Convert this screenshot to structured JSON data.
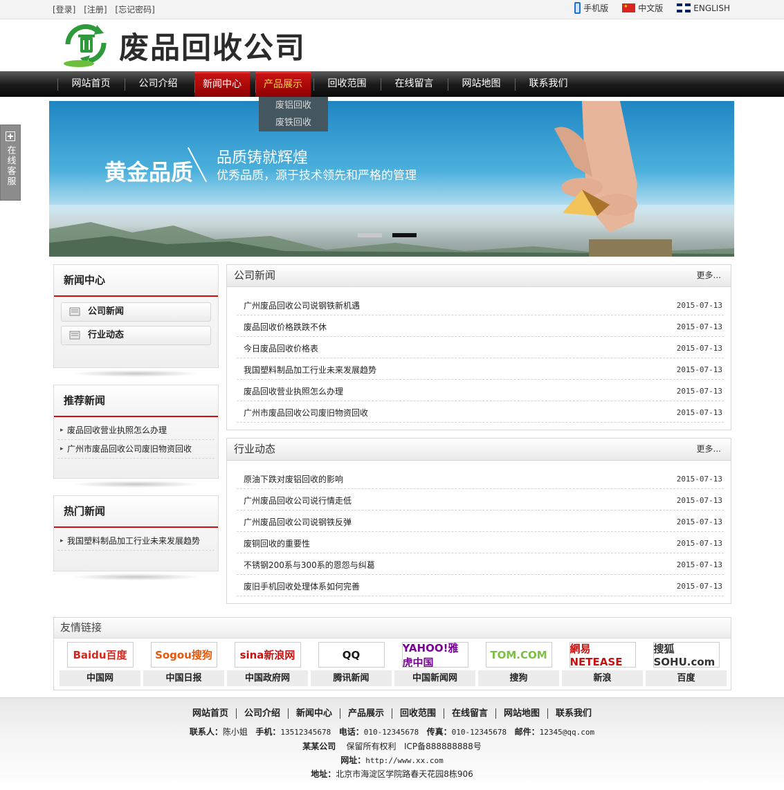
{
  "topbar": {
    "login": "[登录]",
    "register": "[注册]",
    "forgot": "[忘记密码]",
    "mobile": "手机版",
    "chinese": "中文版",
    "english": "ENGLISH"
  },
  "header": {
    "title": "废品回收公司"
  },
  "nav": {
    "items": [
      "网站首页",
      "公司介绍",
      "新闻中心",
      "产品展示",
      "回收范围",
      "在线留言",
      "网站地图",
      "联系我们"
    ],
    "dropdown": [
      "废铝回收",
      "废铁回收"
    ]
  },
  "banner": {
    "headline": "黄金品质",
    "tagline": "品质铸就辉煌",
    "subline": "优秀品质，源于技术领先和严格的管理"
  },
  "service": {
    "label": "在线客服"
  },
  "sidebar": {
    "news_center": {
      "title": "新闻中心",
      "items": [
        "公司新闻",
        "行业动态"
      ]
    },
    "recommended": {
      "title": "推荐新闻",
      "items": [
        "废品回收营业执照怎么办理",
        "广州市废品回收公司废旧物资回收"
      ]
    },
    "hot": {
      "title": "热门新闻",
      "items": [
        "我国塑料制品加工行业未来发展趋势"
      ]
    }
  },
  "company_news": {
    "title": "公司新闻",
    "more": "更多...",
    "items": [
      {
        "title": "广州废品回收公司说钢铁新机遇",
        "date": "2015-07-13"
      },
      {
        "title": "废品回收价格跌跌不休",
        "date": "2015-07-13"
      },
      {
        "title": "今日废品回收价格表",
        "date": "2015-07-13"
      },
      {
        "title": "我国塑料制品加工行业未来发展趋势",
        "date": "2015-07-13"
      },
      {
        "title": "废品回收营业执照怎么办理",
        "date": "2015-07-13"
      },
      {
        "title": "广州市废品回收公司废旧物资回收",
        "date": "2015-07-13"
      }
    ]
  },
  "industry_news": {
    "title": "行业动态",
    "more": "更多...",
    "items": [
      {
        "title": "原油下跌对废铝回收的影响",
        "date": "2015-07-13"
      },
      {
        "title": "广州废品回收公司说行情走低",
        "date": "2015-07-13"
      },
      {
        "title": "广州废品回收公司说钢铁反弹",
        "date": "2015-07-13"
      },
      {
        "title": "废铜回收的重要性",
        "date": "2015-07-13"
      },
      {
        "title": "不锈钢200系与300系的恩怨与纠葛",
        "date": "2015-07-13"
      },
      {
        "title": "废旧手机回收处理体系如何完善",
        "date": "2015-07-13"
      }
    ]
  },
  "friend_links": {
    "title": "友情链接",
    "items": [
      {
        "logo": "Baidu百度",
        "caption": "中国网",
        "color": "#d8261c"
      },
      {
        "logo": "Sogou搜狗",
        "caption": "中国日报",
        "color": "#e8580c"
      },
      {
        "logo": "sina新浪网",
        "caption": "中国政府网",
        "color": "#c81010"
      },
      {
        "logo": "QQ",
        "caption": "腾讯新闻",
        "color": "#1a1a1a"
      },
      {
        "logo": "YAHOO!雅虎中国",
        "caption": "中国新闻网",
        "color": "#7b0099"
      },
      {
        "logo": "TOM.COM",
        "caption": "搜狗",
        "color": "#7bc043"
      },
      {
        "logo": "網易 NETEASE",
        "caption": "新浪",
        "color": "#c81010"
      },
      {
        "logo": "搜狐 SOHU.com",
        "caption": "百度",
        "color": "#333333"
      }
    ]
  },
  "footer": {
    "nav": [
      "网站首页",
      "公司介绍",
      "新闻中心",
      "产品展示",
      "回收范围",
      "在线留言",
      "网站地图",
      "联系我们"
    ],
    "contact_label": "联系人：",
    "contact": "陈小姐",
    "mobile_label": "手机：",
    "mobile": "13512345678",
    "phone_label": "电话：",
    "phone": "010-12345678",
    "fax_label": "传真：",
    "fax": "010-12345678",
    "email_label": "邮件：",
    "email": "12345@qq.com",
    "company": "某某公司",
    "rights": "保留所有权利",
    "icp": "ICP备888888888号",
    "site_label": "网址：",
    "site": "http://www.xx.com",
    "address_label": "地址：",
    "address": "北京市海淀区学院路春天花园8栋906"
  }
}
